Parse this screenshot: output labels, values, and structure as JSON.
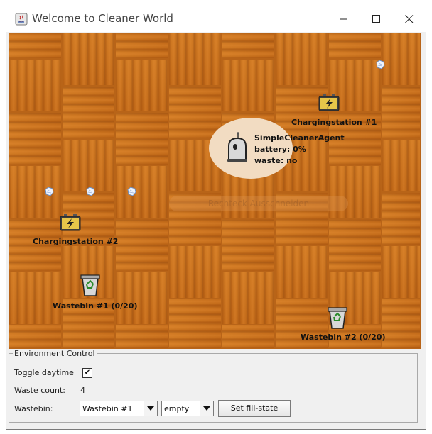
{
  "window": {
    "title": "Welcome to Cleaner World"
  },
  "world": {
    "agent": {
      "name": "SimpleCleanerAgent",
      "battery": "battery: 0%",
      "waste": "waste: no"
    },
    "charging_stations": [
      {
        "label": "Chargingstation #1"
      },
      {
        "label": "Chargingstation #2"
      }
    ],
    "wastebins": [
      {
        "label": "Wastebin #1 (0/20)"
      },
      {
        "label": "Wastebin #2 (0/20)"
      }
    ],
    "overlay_text": "Rechteck Ausschneiden",
    "colors": {
      "floor": "#c8741e",
      "agent_halo": "#f2dcc2"
    }
  },
  "controls": {
    "group_title": "Environment Control",
    "toggle_daytime_label": "Toggle daytime",
    "toggle_daytime_checked": true,
    "waste_count_label": "Waste count:",
    "waste_count_value": "4",
    "wastebin_label": "Wastebin:",
    "wastebin_selected": "Wastebin #1",
    "fill_state_selected": "empty",
    "set_fill_state_label": "Set fill-state"
  }
}
